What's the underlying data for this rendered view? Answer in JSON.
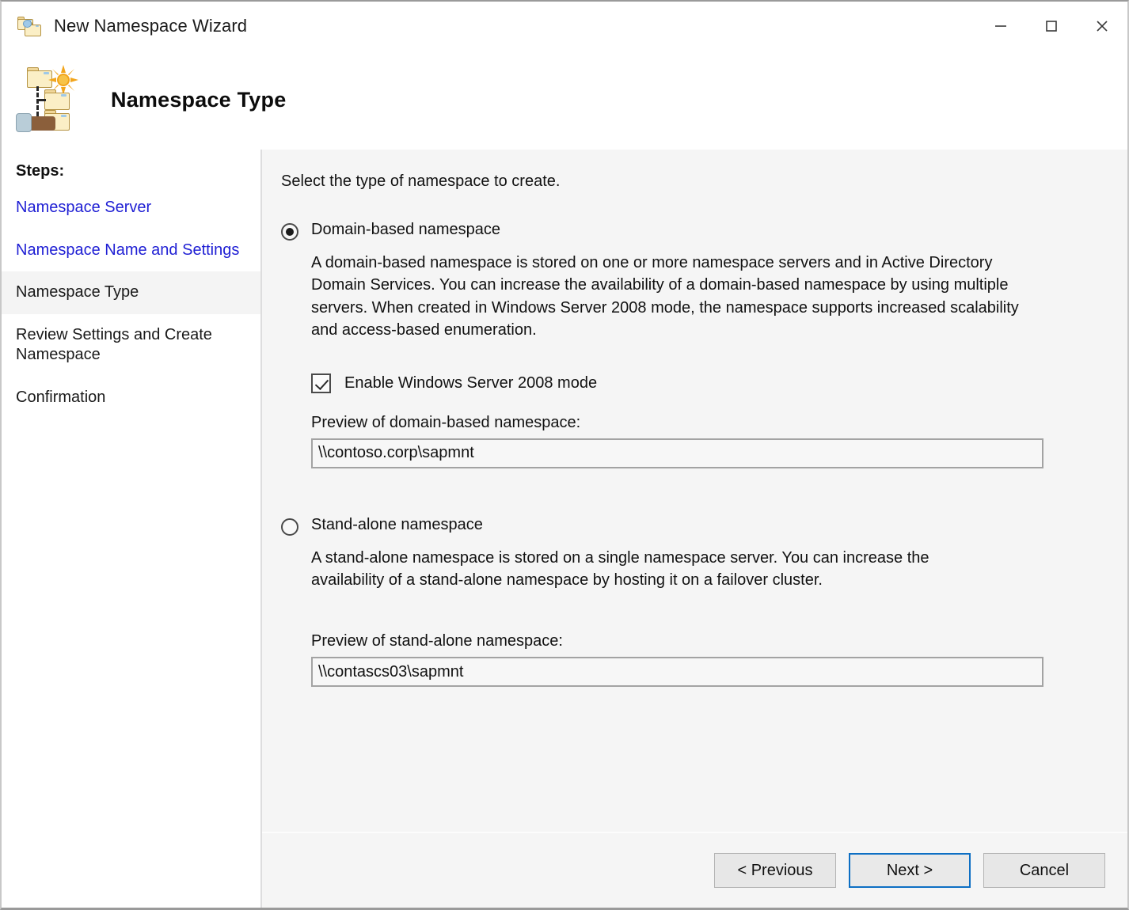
{
  "window": {
    "title": "New Namespace Wizard",
    "icon": "namespace-wizard-icon",
    "controls": {
      "minimize": "minimize-icon",
      "maximize": "maximize-icon",
      "close": "close-icon"
    }
  },
  "header": {
    "title": "Namespace Type",
    "icon": "namespace-type-icon"
  },
  "sidebar": {
    "heading": "Steps:",
    "items": [
      {
        "label": "Namespace Server",
        "state": "link"
      },
      {
        "label": "Namespace Name and Settings",
        "state": "link"
      },
      {
        "label": "Namespace Type",
        "state": "current"
      },
      {
        "label": "Review Settings and Create Namespace",
        "state": "pending"
      },
      {
        "label": "Confirmation",
        "state": "pending"
      }
    ]
  },
  "main": {
    "intro": "Select the type of namespace to create.",
    "options": [
      {
        "id": "domain-based",
        "label": "Domain-based namespace",
        "selected": true,
        "description": "A domain-based namespace is stored on one or more namespace servers and in Active Directory Domain Services. You can increase the availability of a domain-based namespace by using multiple servers. When created in Windows Server 2008 mode, the namespace supports increased scalability and access-based enumeration.",
        "checkbox": {
          "label": "Enable Windows Server 2008 mode",
          "checked": true
        },
        "preview_label": "Preview of domain-based namespace:",
        "preview_value": "\\\\contoso.corp\\sapmnt"
      },
      {
        "id": "stand-alone",
        "label": "Stand-alone namespace",
        "selected": false,
        "description": "A stand-alone namespace is stored on a single namespace server. You can increase the availability of a stand-alone namespace by hosting it on a failover cluster.",
        "preview_label": "Preview of stand-alone namespace:",
        "preview_value": "\\\\contascs03\\sapmnt"
      }
    ]
  },
  "footer": {
    "previous": "< Previous",
    "next": "Next >",
    "cancel": "Cancel"
  },
  "colors": {
    "link": "#1f1fd4",
    "accent": "#0d6fc4",
    "content_bg": "#f5f5f5"
  }
}
